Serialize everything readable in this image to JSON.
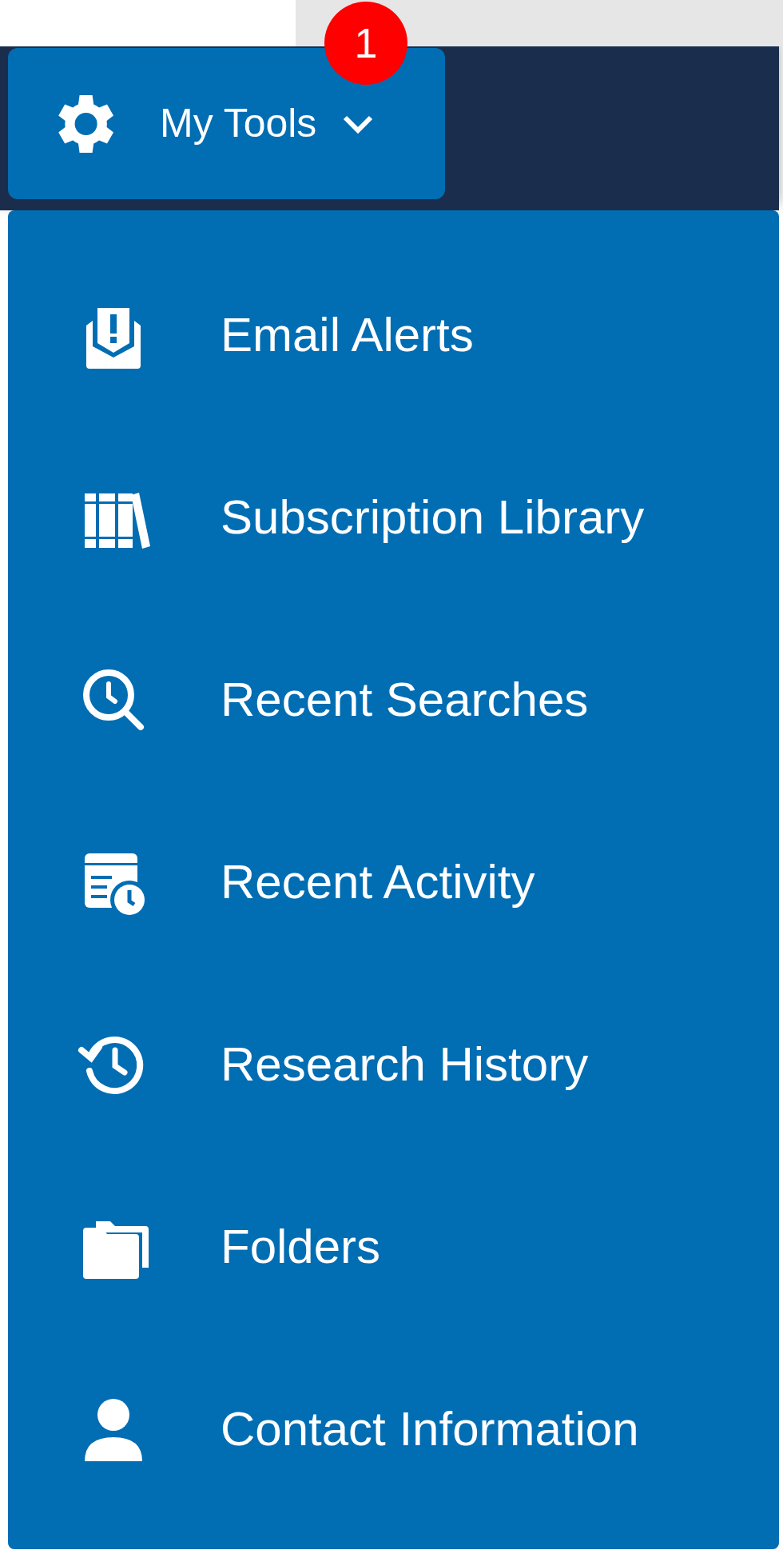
{
  "menu_button": {
    "label": "My Tools",
    "badge": "1",
    "expanded": true
  },
  "menu": {
    "items": [
      {
        "label": "Email Alerts"
      },
      {
        "label": "Subscription Library"
      },
      {
        "label": "Recent Searches"
      },
      {
        "label": "Recent Activity"
      },
      {
        "label": "Research History"
      },
      {
        "label": "Folders"
      },
      {
        "label": "Contact Information"
      }
    ]
  }
}
